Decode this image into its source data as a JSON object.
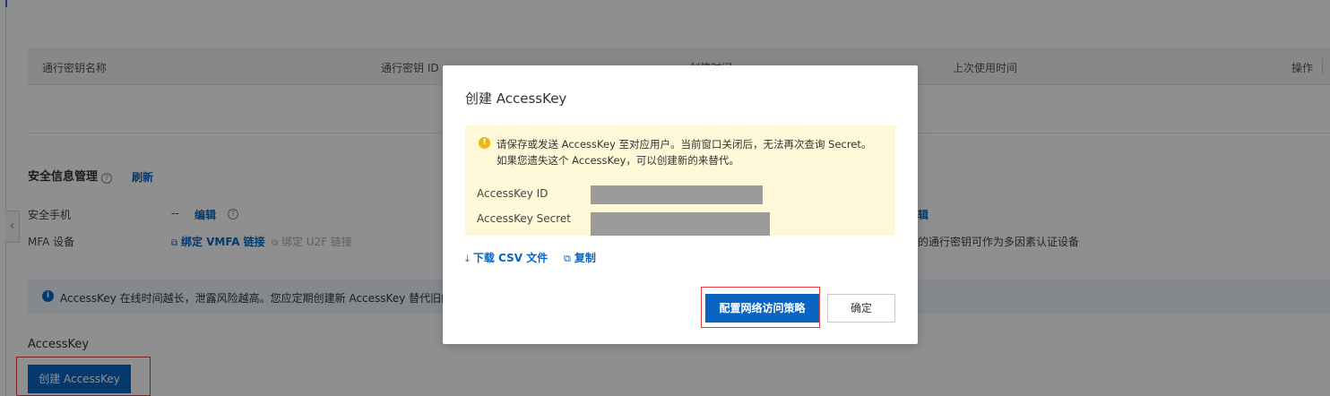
{
  "table": {
    "col_name": "通行密钥名称",
    "col_id": "通行密钥 ID",
    "col_created": "创建时间",
    "col_last_used": "上次使用时间",
    "col_ops": "操作"
  },
  "security": {
    "title": "安全信息管理",
    "help": "?",
    "refresh": "刷新",
    "phone_label": "安全手机",
    "phone_value": "--",
    "phone_edit": "编辑",
    "phone_help": "?",
    "mfa_label": "MFA 设备",
    "bind_vmfa": "绑定 VMFA 链接",
    "bind_u2f": "绑定 U2F 链接",
    "right_edit": "辑",
    "right_note": "的通行密钥可作为多因素认证设备"
  },
  "banner": {
    "icon": "i",
    "text": "AccessKey 在线时间越长，泄露风险越高。您应定期创建新 AccessKey 替代旧的。"
  },
  "accesskey": {
    "title": "AccessKey",
    "create_button": "创建 AccessKey"
  },
  "modal": {
    "title": "创建 AccessKey",
    "warn_icon": "!",
    "warn_line1": "请保存或发送 AccessKey 至对应用户。当前窗口关闭后，无法再次查询 Secret。",
    "warn_line2": "如果您遗失这个 AccessKey，可以创建新的来替代。",
    "id_label": "AccessKey ID",
    "secret_label": "AccessKey Secret",
    "download_icon": "⤓",
    "download_csv": "下载 CSV 文件",
    "copy_icon": "⧉",
    "copy": "复制",
    "primary_button": "配置网络访问策略",
    "confirm_button": "确定"
  },
  "colors": {
    "primary": "#0a64c2",
    "highlight": "#e23c3c",
    "warning_bg": "#fff8d8"
  }
}
